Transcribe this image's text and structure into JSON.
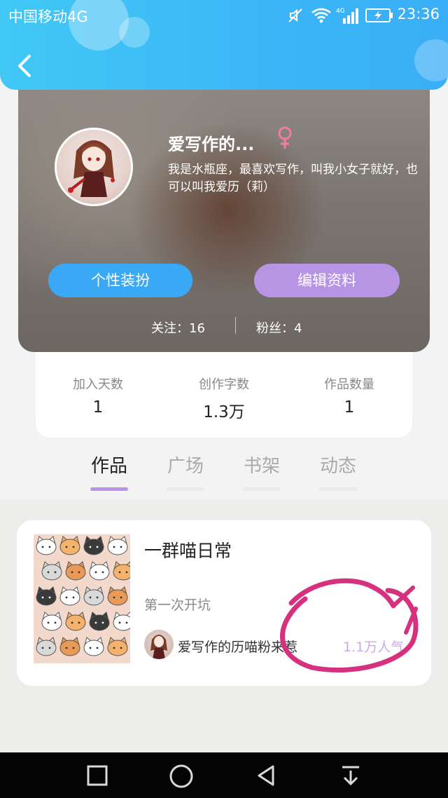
{
  "status_bar": {
    "carrier": "中国移动4G",
    "time": "23:36",
    "network_badge": "4G",
    "icons": [
      "mute-icon",
      "wifi-icon",
      "signal-icon",
      "battery-charging-icon"
    ]
  },
  "header": {
    "back_icon": "chevron-left-icon",
    "accent_color": "#3bb6f7"
  },
  "profile": {
    "nickname": "爱写作的...",
    "gender_icon": "female-icon",
    "bio": "我是水瓶座，最喜欢写作，叫我小女子就好，也可以叫我爱历（莉）",
    "buttons": {
      "dress_up": "个性装扮",
      "edit_profile": "编辑资料"
    },
    "following": "关注：16",
    "fans": "粉丝：4"
  },
  "stats": [
    {
      "label": "加入天数",
      "value": "1"
    },
    {
      "label": "创作字数",
      "value": "1.3万"
    },
    {
      "label": "作品数量",
      "value": "1"
    }
  ],
  "tabs": [
    {
      "label": "作品",
      "active": true
    },
    {
      "label": "广场",
      "active": false
    },
    {
      "label": "书架",
      "active": false
    },
    {
      "label": "动态",
      "active": false
    }
  ],
  "work": {
    "title": "一群喵日常",
    "chapter": "第一次开坑",
    "author": "爱写作的历喵粉来惹",
    "popularity": "1.1万人气"
  },
  "colors": {
    "tab_indicator": "#b794e4",
    "edit_button": "#b794e4",
    "dress_button": "#3aa9f5",
    "popularity": "#c9a8ee",
    "annotation": "#d6317e"
  },
  "nav_bar": [
    "recent-apps-icon",
    "home-icon",
    "back-icon",
    "notification-down-icon"
  ]
}
